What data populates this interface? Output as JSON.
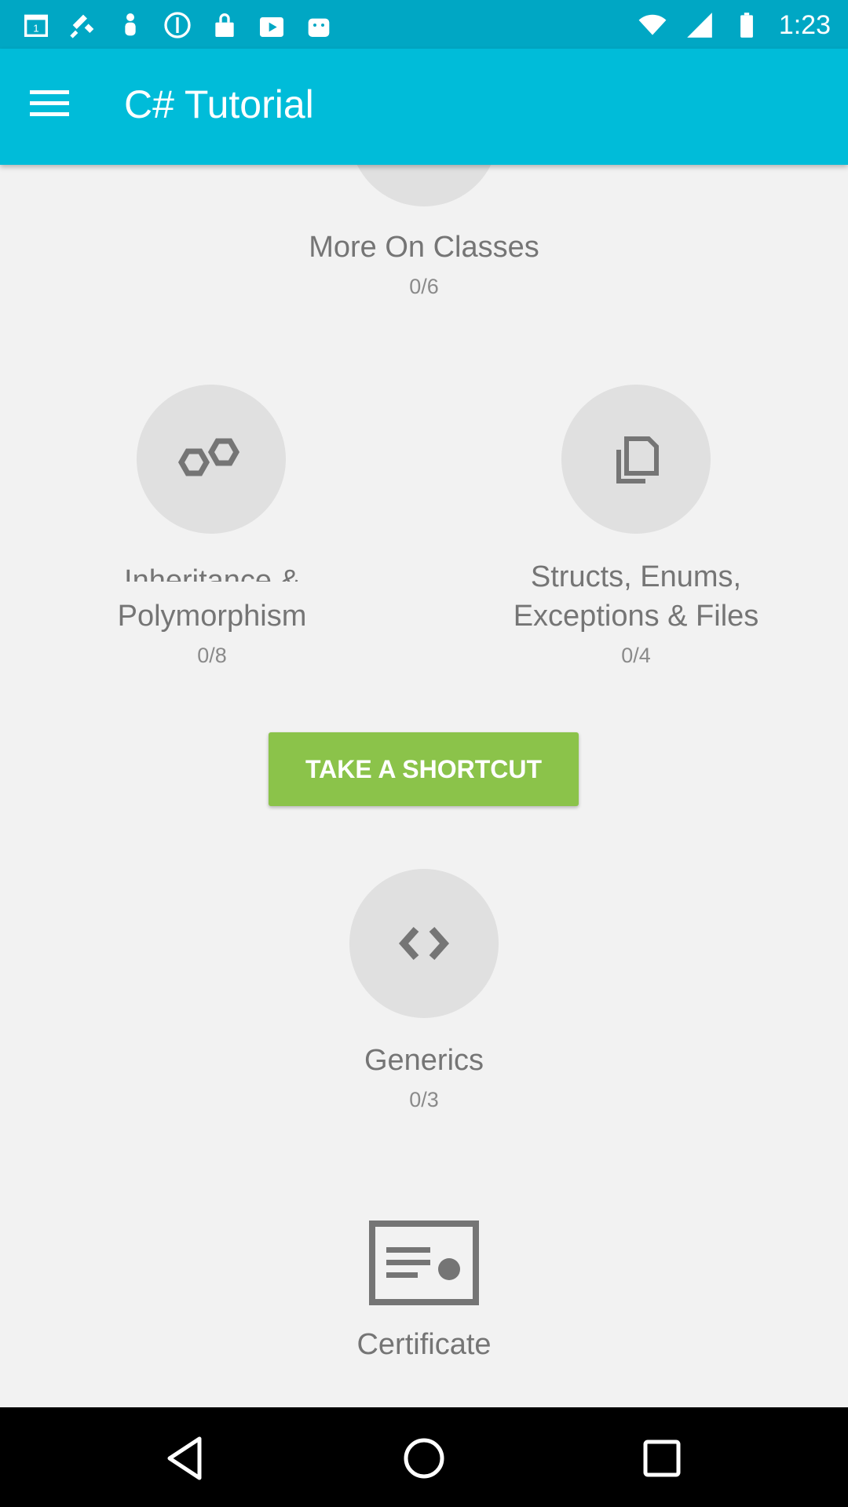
{
  "status_bar": {
    "time": "1:23",
    "icons": [
      "calendar-icon",
      "fake-gps-icon",
      "notification-icon",
      "data-saver-icon",
      "lock-icon",
      "play-store-icon",
      "android-icon"
    ],
    "right_icons": [
      "wifi-icon",
      "signal-icon",
      "battery-icon"
    ]
  },
  "app_bar": {
    "title": "C# Tutorial",
    "menu_icon": "hamburger-menu-icon"
  },
  "lessons": [
    {
      "title": "More On Classes",
      "progress": "0/6"
    },
    {
      "title_line1": "Inheritance &",
      "title_line2": "Polymorphism",
      "progress": "0/8",
      "icon": "hexagons-icon"
    },
    {
      "title_line1": "Structs, Enums,",
      "title_line2": "Exceptions & Files",
      "progress": "0/4",
      "icon": "files-icon"
    },
    {
      "title": "Generics",
      "progress": "0/3",
      "icon": "code-brackets-icon"
    }
  ],
  "shortcut_button": {
    "label": "TAKE A SHORTCUT"
  },
  "certificate": {
    "label": "Certificate",
    "icon": "certificate-icon"
  },
  "colors": {
    "app_bar": "#00bcd9",
    "status_bar": "#00a7c4",
    "shortcut": "#8bc34a",
    "background": "#f2f2f2"
  },
  "nav_bar": {
    "icons": [
      "back-icon",
      "home-icon",
      "recents-icon"
    ]
  }
}
